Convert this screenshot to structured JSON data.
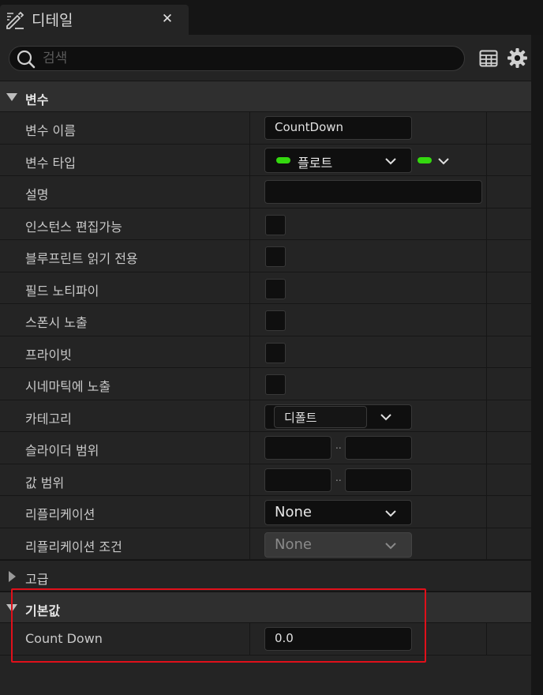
{
  "tab": {
    "title": "디테일",
    "icon": "edit-pencil-icon",
    "close": "✕"
  },
  "search": {
    "placeholder": "검색",
    "value": ""
  },
  "sections": {
    "variables": {
      "label": "변수"
    },
    "advanced": {
      "label": "고급"
    },
    "default_value": {
      "label": "기본값"
    }
  },
  "fields": {
    "var_name": {
      "label": "변수 이름",
      "value": "CountDown"
    },
    "var_type": {
      "label": "변수 타입",
      "value": "플로트"
    },
    "description": {
      "label": "설명",
      "value": ""
    },
    "instance_editable": {
      "label": "인스턴스 편집가능"
    },
    "blueprint_readonly": {
      "label": "블루프린트 읽기 전용"
    },
    "field_notify": {
      "label": "필드 노티파이"
    },
    "expose_spawn": {
      "label": "스폰시 노출"
    },
    "private": {
      "label": "프라이빗"
    },
    "expose_cinematic": {
      "label": "시네마틱에 노출"
    },
    "category": {
      "label": "카테고리",
      "value": "디폴트"
    },
    "slider_range": {
      "label": "슬라이더 범위",
      "separator": ".."
    },
    "value_range": {
      "label": "값 범위",
      "separator": ".."
    },
    "replication": {
      "label": "리플리케이션",
      "value": "None"
    },
    "replication_condition": {
      "label": "리플리케이션 조건",
      "value": "None"
    },
    "count_down": {
      "label": "Count Down",
      "value": "0.0"
    }
  },
  "colors": {
    "float_pin": "#34d80f",
    "highlight": "#e0101a"
  }
}
